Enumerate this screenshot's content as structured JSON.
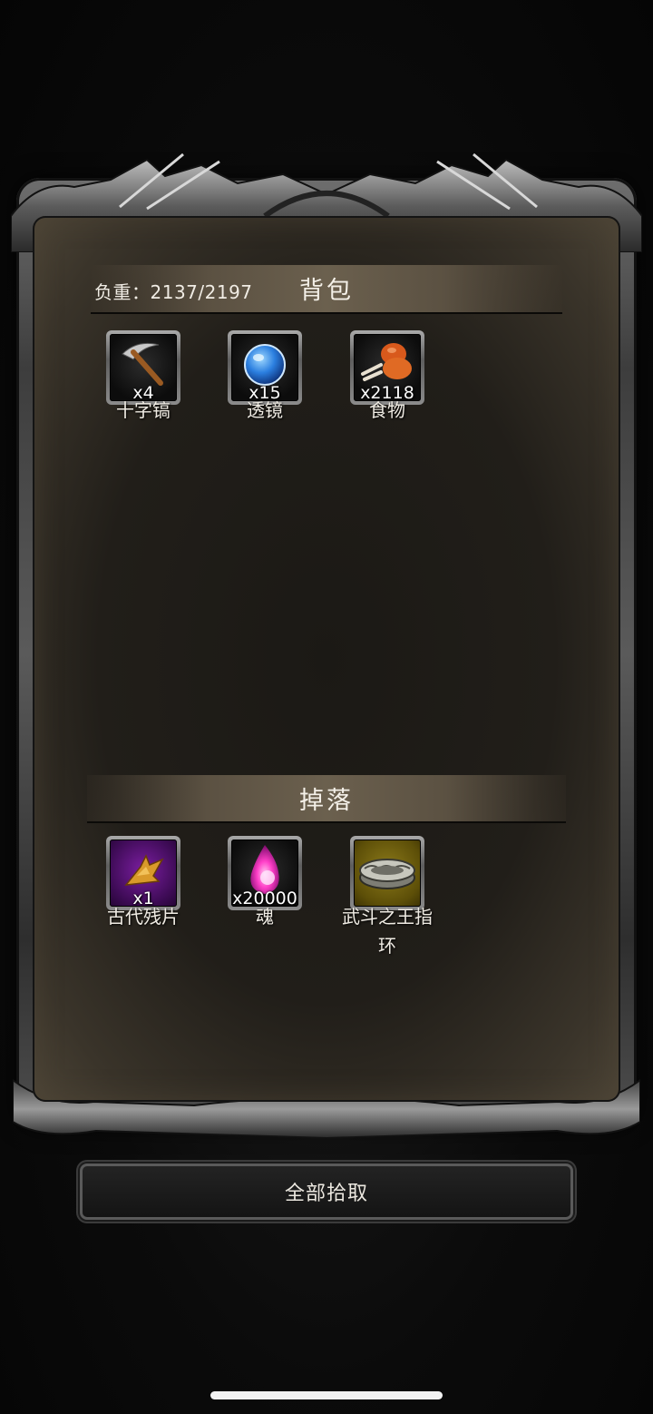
{
  "backpack": {
    "weight_label": "负重：2137/2197",
    "title": "背包",
    "items": [
      {
        "name": "十字镐",
        "qty": "x4",
        "icon": "pickaxe-icon"
      },
      {
        "name": "透镜",
        "qty": "x15",
        "icon": "lens-orb-icon"
      },
      {
        "name": "食物",
        "qty": "x2118",
        "icon": "meat-drumstick-icon"
      }
    ]
  },
  "drops": {
    "title": "掉落",
    "items": [
      {
        "name": "古代残片",
        "qty": "x1",
        "icon": "ancient-fragment-icon",
        "rarity": "purple"
      },
      {
        "name": "魂",
        "qty": "x20000",
        "icon": "soul-flame-icon"
      },
      {
        "name_line1": "武斗之王指",
        "name_line2": "环",
        "icon": "ring-icon",
        "rarity": "gold"
      }
    ]
  },
  "actions": {
    "pickup_all": "全部拾取"
  },
  "colors": {
    "panel": "#211e19",
    "header_bar": "#6b604e",
    "purple_rarity": "#7b1ea0",
    "gold_rarity": "#8c7a1a"
  }
}
